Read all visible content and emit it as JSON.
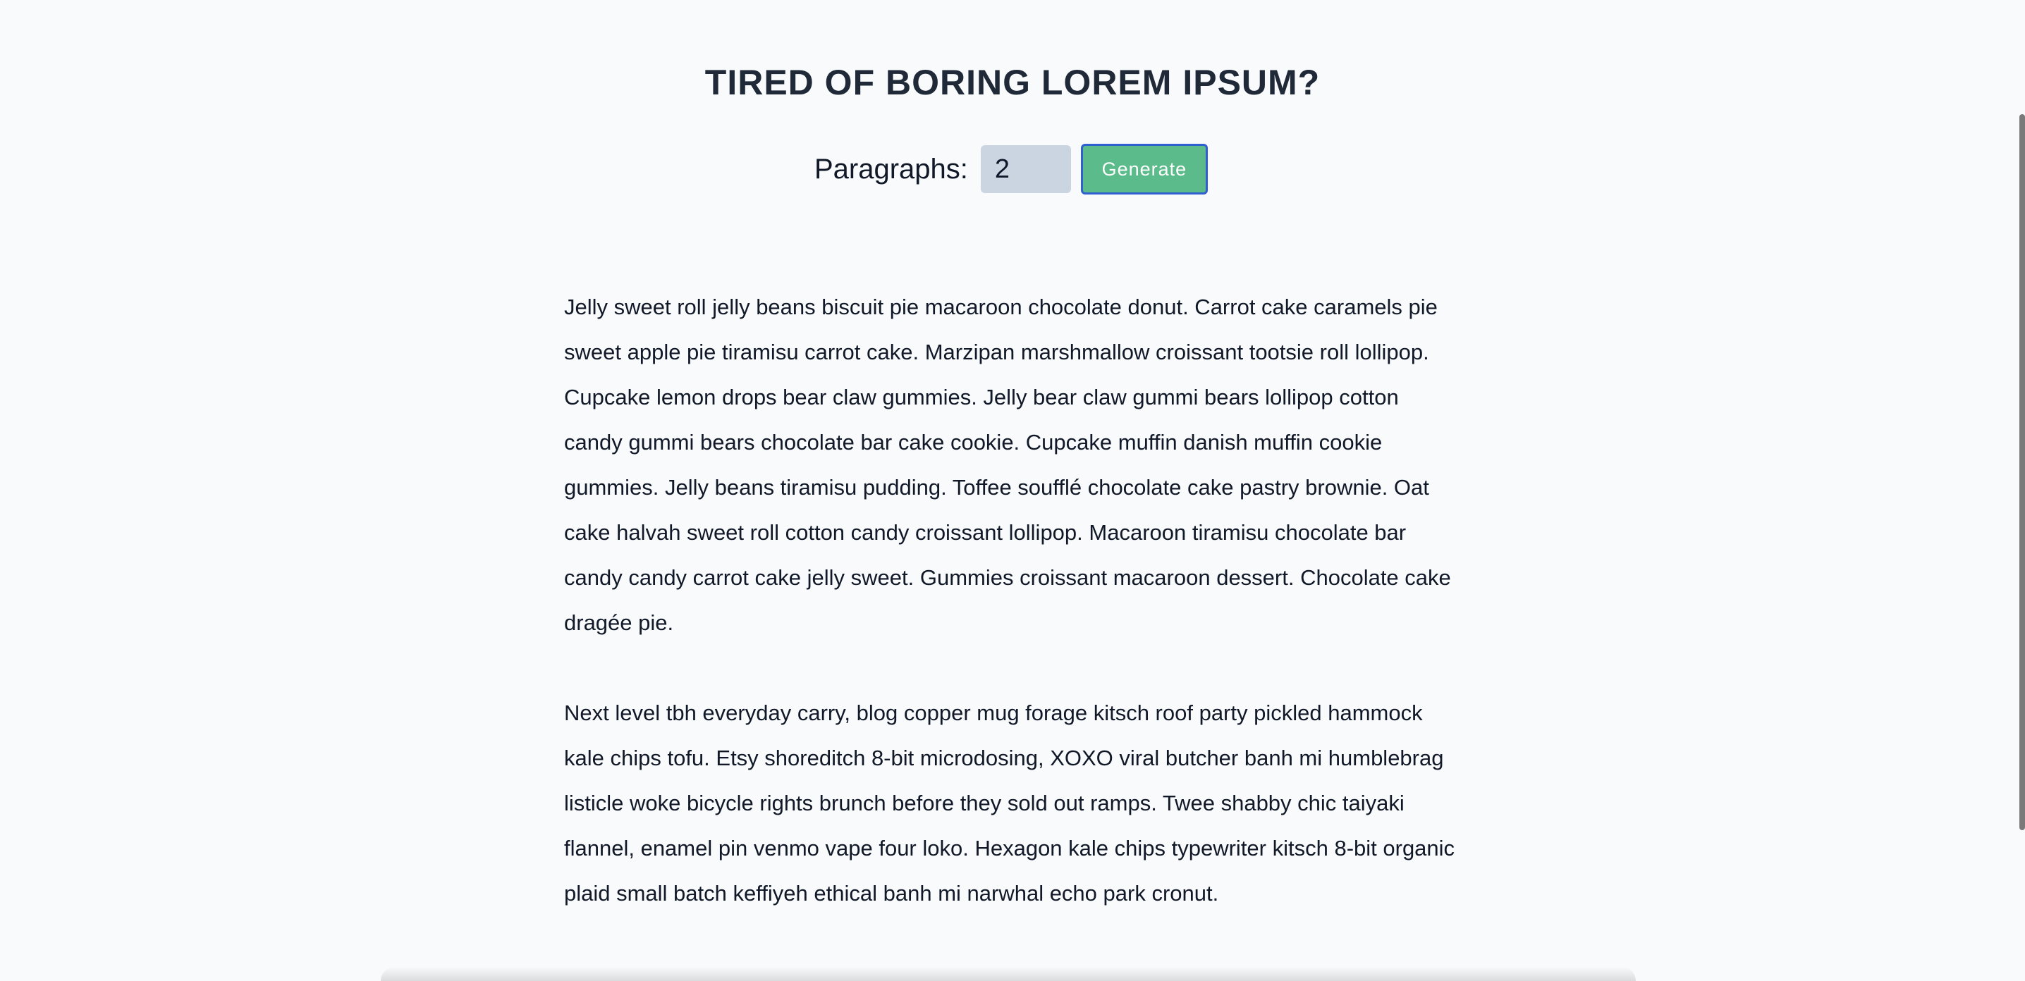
{
  "header": {
    "title": "TIRED OF BORING LOREM IPSUM?"
  },
  "controls": {
    "paragraphs_label": "Paragraphs:",
    "paragraphs_value": "2",
    "generate_label": "Generate"
  },
  "content": {
    "paragraphs": [
      "Jelly sweet roll jelly beans biscuit pie macaroon chocolate donut. Carrot cake caramels pie sweet apple pie tiramisu carrot cake. Marzipan marshmallow croissant tootsie roll lollipop. Cupcake lemon drops bear claw gummies. Jelly bear claw gummi bears lollipop cotton candy gummi bears chocolate bar cake cookie. Cupcake muffin danish muffin cookie gummies. Jelly beans tiramisu pudding. Toffee soufflé chocolate cake pastry brownie. Oat cake halvah sweet roll cotton candy croissant lollipop. Macaroon tiramisu chocolate bar candy candy carrot cake jelly sweet. Gummies croissant macaroon dessert. Chocolate cake dragée pie.",
      "Next level tbh everyday carry, blog copper mug forage kitsch roof party pickled hammock kale chips tofu. Etsy shoreditch 8-bit microdosing, XOXO viral butcher banh mi humblebrag listicle woke bicycle rights brunch before they sold out ramps. Twee shabby chic taiyaki flannel, enamel pin venmo vape four loko. Hexagon kale chips typewriter kitsch 8-bit organic plaid small batch keffiyeh ethical banh mi narwhal echo park cronut."
    ]
  },
  "colors": {
    "background": "#f8fafc",
    "button": "#5bbb8a",
    "button_border": "#2f5fd0",
    "input_bg": "#cbd5e1"
  }
}
